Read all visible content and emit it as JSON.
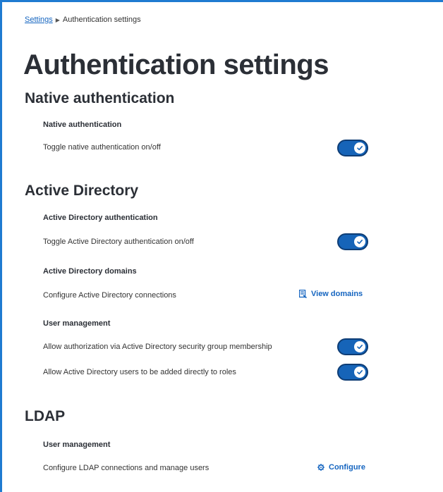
{
  "breadcrumb": {
    "parent": "Settings",
    "current": "Authentication settings"
  },
  "page_title": "Authentication settings",
  "native": {
    "section_title": "Native authentication",
    "subsection_title": "Native authentication",
    "toggle_label": "Toggle native authentication on/off",
    "toggle_on": true
  },
  "active_directory": {
    "section_title": "Active Directory",
    "auth_title": "Active Directory authentication",
    "auth_toggle_label": "Toggle Active Directory authentication on/off",
    "auth_toggle_on": true,
    "domains_title": "Active Directory domains",
    "domains_label": "Configure Active Directory connections",
    "view_domains": "View domains",
    "user_mgmt_title": "User management",
    "group_membership_label": "Allow authorization via Active Directory security group membership",
    "group_membership_on": true,
    "roles_label": "Allow Active Directory users to be added directly to roles",
    "roles_on": true
  },
  "ldap": {
    "section_title": "LDAP",
    "user_mgmt_title": "User management",
    "configure_label": "Configure LDAP connections and manage users",
    "configure_button": "Configure"
  },
  "colors": {
    "accent": "#1f7bd1",
    "toggle_on": "#1664b8",
    "link": "#1565c0",
    "heading": "#2b2f36"
  }
}
